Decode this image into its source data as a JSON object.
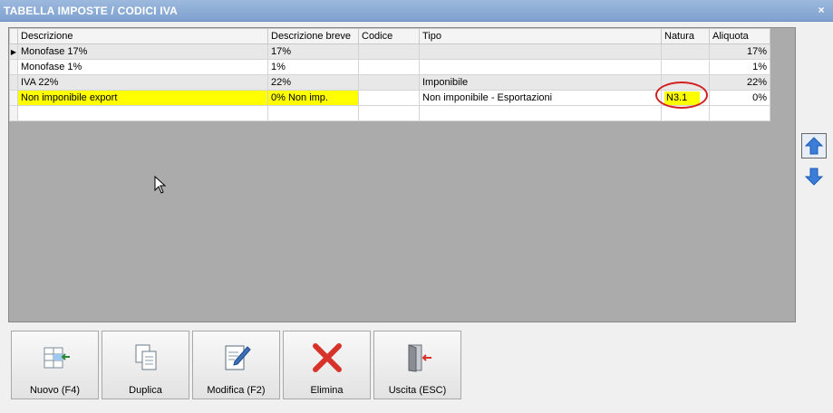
{
  "window": {
    "title": "TABELLA IMPOSTE / CODICI IVA",
    "close_glyph": "×"
  },
  "grid": {
    "columns": [
      "Descrizione",
      "Descrizione breve",
      "Codice",
      "Tipo",
      "Natura",
      "Aliquota"
    ],
    "rows": [
      {
        "descrizione": "Monofase 17%",
        "breve": "17%",
        "codice": "",
        "tipo": "",
        "natura": "",
        "aliquota": "17%"
      },
      {
        "descrizione": "Monofase 1%",
        "breve": "1%",
        "codice": "",
        "tipo": "",
        "natura": "",
        "aliquota": "1%"
      },
      {
        "descrizione": "IVA 22%",
        "breve": "22%",
        "codice": "",
        "tipo": "Imponibile",
        "natura": "",
        "aliquota": "22%"
      },
      {
        "descrizione": "Non imponibile export",
        "breve": "0% Non imp.",
        "codice": "",
        "tipo": "Non imponibile - Esportazioni",
        "natura": "N3.1",
        "aliquota": "0%"
      }
    ],
    "current_row_indicator": "▶",
    "highlight_color": "#ffff00",
    "annotation_color": "#d42020"
  },
  "side": {
    "up_icon": "arrow-up-icon",
    "down_icon": "arrow-down-icon"
  },
  "buttons": {
    "nuovo": "Nuovo (F4)",
    "duplica": "Duplica",
    "modifica": "Modifica (F2)",
    "elimina": "Elimina",
    "uscita": "Uscita (ESC)"
  }
}
